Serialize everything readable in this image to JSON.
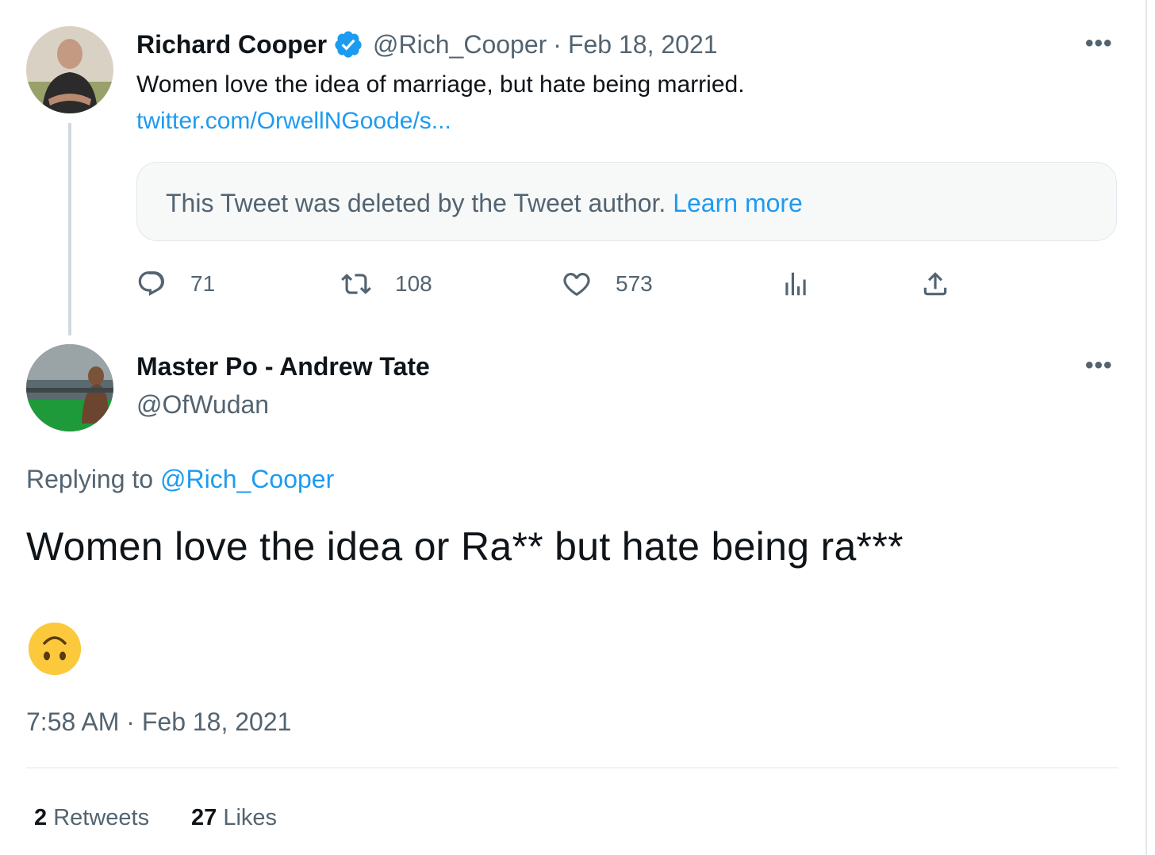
{
  "original_tweet": {
    "author_name": "Richard Cooper",
    "verified": true,
    "handle": "@Rich_Cooper",
    "separator": "·",
    "date": "Feb 18, 2021",
    "text": "Women love the idea of marriage, but hate being married.",
    "link": "twitter.com/OrwellNGoode/s...",
    "deleted_notice": "This Tweet was deleted by the Tweet author.",
    "learn_more": "Learn more",
    "replies": "71",
    "retweets": "108",
    "likes": "573",
    "more_icon": "more-horizontal-icon"
  },
  "reply_tweet": {
    "author_name": "Master Po - Andrew Tate",
    "handle": "@OfWudan",
    "replying_to_label": "Replying to",
    "replying_to_handle": "@Rich_Cooper",
    "text": "Women love the idea or Ra** but hate being ra***",
    "emoji": "upside-down-face",
    "timestamp": "7:58 AM · Feb 18, 2021",
    "retweets_count": "2",
    "retweets_label": "Retweets",
    "likes_count": "27",
    "likes_label": "Likes"
  },
  "colors": {
    "link": "#1d9bf0",
    "muted": "#536471",
    "text": "#0f1419",
    "verified": "#1d9bf0"
  }
}
